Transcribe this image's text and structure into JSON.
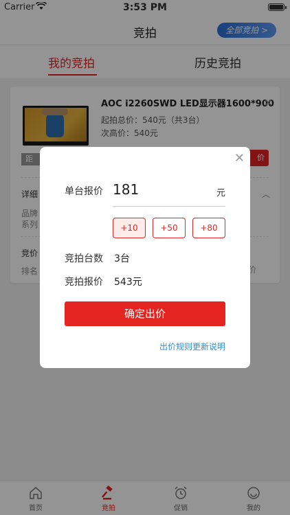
{
  "status": {
    "carrier": "Carrier",
    "time": "3:53 PM"
  },
  "nav": {
    "title": "竞拍",
    "all_auctions": "全部竞拍 >"
  },
  "tabs": {
    "mine": "我的竞拍",
    "history": "历史竞拍"
  },
  "card": {
    "product": "AOC i2260SWD LED显示器1600*900",
    "start_total": "起拍总价：540元（共3台）",
    "second_high": "次高价：540元",
    "distance_stub": "距",
    "bid_stub": "价",
    "detail_stub": "详细",
    "brand_stub": "品牌",
    "series_stub": "系列",
    "bid_stub2": "竞价",
    "rank_stub": "排名",
    "right_stub": "价"
  },
  "modal": {
    "unit_price_label": "单台报价",
    "unit_price_value": "181",
    "unit_price_unit": "元",
    "increments": [
      "+10",
      "+50",
      "+80"
    ],
    "selected_increment": "+10",
    "qty_label": "竞拍台数",
    "qty_value": "3台",
    "bid_label": "竞拍报价",
    "bid_value": "543元",
    "confirm": "确定出价",
    "rules_link": "出价规则更新说明"
  },
  "tabbar": [
    {
      "label": "首页",
      "icon": "home-icon"
    },
    {
      "label": "竞拍",
      "icon": "gavel-icon"
    },
    {
      "label": "促销",
      "icon": "alarm-clock-icon"
    },
    {
      "label": "我的",
      "icon": "smile-icon"
    }
  ],
  "colors": {
    "accent": "#e32421",
    "link": "#2a8fd6",
    "nav_button": "#2a6fd6"
  }
}
